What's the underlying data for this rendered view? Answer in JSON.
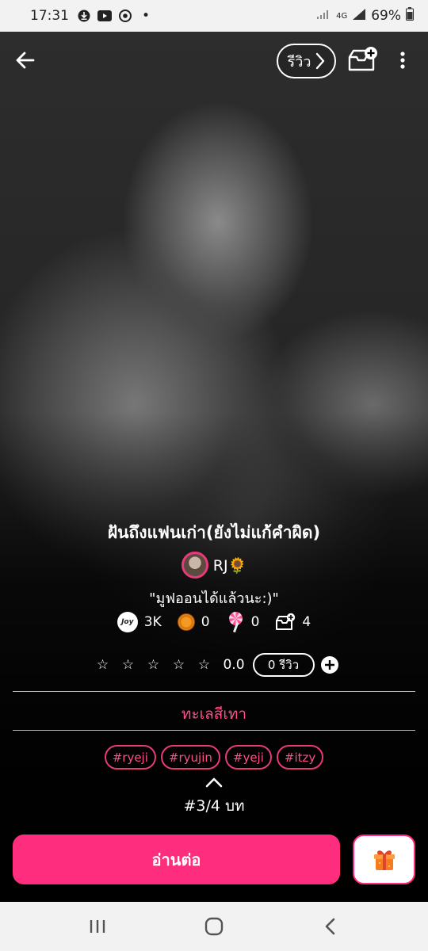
{
  "status_bar": {
    "time": "17:31",
    "network": "4G",
    "battery": "69%",
    "dot": "•"
  },
  "header": {
    "review_label": "รีวิว"
  },
  "story": {
    "title": "ฝันถึงแฟนเก่า(ยังไม่แก้คำผิด)",
    "author": "RJ🌻",
    "quote": "\"มูฟออนได้แล้วนะ:)\"",
    "stats": {
      "joy_label": "Joy",
      "joy": "3K",
      "coins": "0",
      "lollipops": "0",
      "library_adds": "4"
    },
    "rating": {
      "value": "0.0",
      "stars_filled": 0,
      "stars_total": 5,
      "review_count": "0 รีวิว",
      "star_glyph": "☆"
    },
    "category": "ทะเลสีเทา",
    "tags": [
      "#ryeji",
      "#ryujin",
      "#yeji",
      "#itzy"
    ],
    "chapter": "#3/4 บท"
  },
  "actions": {
    "read_label": "อ่านต่อ"
  },
  "colors": {
    "accent": "#ff2d7d",
    "tag_text": "#ff4f8b"
  }
}
